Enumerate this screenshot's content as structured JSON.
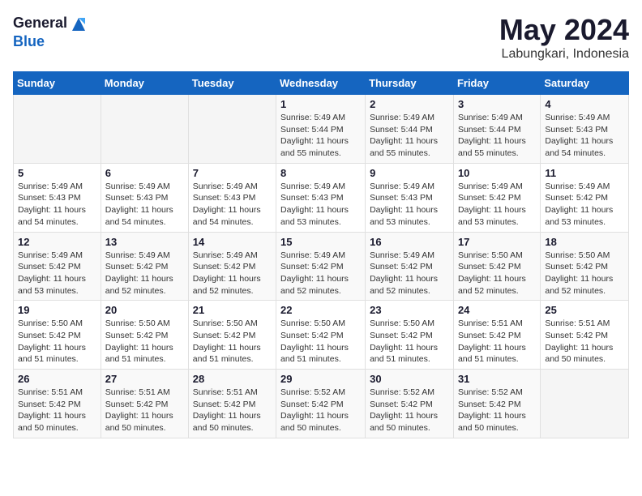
{
  "logo": {
    "general": "General",
    "blue": "Blue"
  },
  "title": {
    "month_year": "May 2024",
    "location": "Labungkari, Indonesia"
  },
  "weekdays": [
    "Sunday",
    "Monday",
    "Tuesday",
    "Wednesday",
    "Thursday",
    "Friday",
    "Saturday"
  ],
  "weeks": [
    [
      {
        "day": "",
        "sunrise": "",
        "sunset": "",
        "daylight": ""
      },
      {
        "day": "",
        "sunrise": "",
        "sunset": "",
        "daylight": ""
      },
      {
        "day": "",
        "sunrise": "",
        "sunset": "",
        "daylight": ""
      },
      {
        "day": "1",
        "sunrise": "Sunrise: 5:49 AM",
        "sunset": "Sunset: 5:44 PM",
        "daylight": "Daylight: 11 hours and 55 minutes."
      },
      {
        "day": "2",
        "sunrise": "Sunrise: 5:49 AM",
        "sunset": "Sunset: 5:44 PM",
        "daylight": "Daylight: 11 hours and 55 minutes."
      },
      {
        "day": "3",
        "sunrise": "Sunrise: 5:49 AM",
        "sunset": "Sunset: 5:44 PM",
        "daylight": "Daylight: 11 hours and 55 minutes."
      },
      {
        "day": "4",
        "sunrise": "Sunrise: 5:49 AM",
        "sunset": "Sunset: 5:43 PM",
        "daylight": "Daylight: 11 hours and 54 minutes."
      }
    ],
    [
      {
        "day": "5",
        "sunrise": "Sunrise: 5:49 AM",
        "sunset": "Sunset: 5:43 PM",
        "daylight": "Daylight: 11 hours and 54 minutes."
      },
      {
        "day": "6",
        "sunrise": "Sunrise: 5:49 AM",
        "sunset": "Sunset: 5:43 PM",
        "daylight": "Daylight: 11 hours and 54 minutes."
      },
      {
        "day": "7",
        "sunrise": "Sunrise: 5:49 AM",
        "sunset": "Sunset: 5:43 PM",
        "daylight": "Daylight: 11 hours and 54 minutes."
      },
      {
        "day": "8",
        "sunrise": "Sunrise: 5:49 AM",
        "sunset": "Sunset: 5:43 PM",
        "daylight": "Daylight: 11 hours and 53 minutes."
      },
      {
        "day": "9",
        "sunrise": "Sunrise: 5:49 AM",
        "sunset": "Sunset: 5:43 PM",
        "daylight": "Daylight: 11 hours and 53 minutes."
      },
      {
        "day": "10",
        "sunrise": "Sunrise: 5:49 AM",
        "sunset": "Sunset: 5:42 PM",
        "daylight": "Daylight: 11 hours and 53 minutes."
      },
      {
        "day": "11",
        "sunrise": "Sunrise: 5:49 AM",
        "sunset": "Sunset: 5:42 PM",
        "daylight": "Daylight: 11 hours and 53 minutes."
      }
    ],
    [
      {
        "day": "12",
        "sunrise": "Sunrise: 5:49 AM",
        "sunset": "Sunset: 5:42 PM",
        "daylight": "Daylight: 11 hours and 53 minutes."
      },
      {
        "day": "13",
        "sunrise": "Sunrise: 5:49 AM",
        "sunset": "Sunset: 5:42 PM",
        "daylight": "Daylight: 11 hours and 52 minutes."
      },
      {
        "day": "14",
        "sunrise": "Sunrise: 5:49 AM",
        "sunset": "Sunset: 5:42 PM",
        "daylight": "Daylight: 11 hours and 52 minutes."
      },
      {
        "day": "15",
        "sunrise": "Sunrise: 5:49 AM",
        "sunset": "Sunset: 5:42 PM",
        "daylight": "Daylight: 11 hours and 52 minutes."
      },
      {
        "day": "16",
        "sunrise": "Sunrise: 5:49 AM",
        "sunset": "Sunset: 5:42 PM",
        "daylight": "Daylight: 11 hours and 52 minutes."
      },
      {
        "day": "17",
        "sunrise": "Sunrise: 5:50 AM",
        "sunset": "Sunset: 5:42 PM",
        "daylight": "Daylight: 11 hours and 52 minutes."
      },
      {
        "day": "18",
        "sunrise": "Sunrise: 5:50 AM",
        "sunset": "Sunset: 5:42 PM",
        "daylight": "Daylight: 11 hours and 52 minutes."
      }
    ],
    [
      {
        "day": "19",
        "sunrise": "Sunrise: 5:50 AM",
        "sunset": "Sunset: 5:42 PM",
        "daylight": "Daylight: 11 hours and 51 minutes."
      },
      {
        "day": "20",
        "sunrise": "Sunrise: 5:50 AM",
        "sunset": "Sunset: 5:42 PM",
        "daylight": "Daylight: 11 hours and 51 minutes."
      },
      {
        "day": "21",
        "sunrise": "Sunrise: 5:50 AM",
        "sunset": "Sunset: 5:42 PM",
        "daylight": "Daylight: 11 hours and 51 minutes."
      },
      {
        "day": "22",
        "sunrise": "Sunrise: 5:50 AM",
        "sunset": "Sunset: 5:42 PM",
        "daylight": "Daylight: 11 hours and 51 minutes."
      },
      {
        "day": "23",
        "sunrise": "Sunrise: 5:50 AM",
        "sunset": "Sunset: 5:42 PM",
        "daylight": "Daylight: 11 hours and 51 minutes."
      },
      {
        "day": "24",
        "sunrise": "Sunrise: 5:51 AM",
        "sunset": "Sunset: 5:42 PM",
        "daylight": "Daylight: 11 hours and 51 minutes."
      },
      {
        "day": "25",
        "sunrise": "Sunrise: 5:51 AM",
        "sunset": "Sunset: 5:42 PM",
        "daylight": "Daylight: 11 hours and 50 minutes."
      }
    ],
    [
      {
        "day": "26",
        "sunrise": "Sunrise: 5:51 AM",
        "sunset": "Sunset: 5:42 PM",
        "daylight": "Daylight: 11 hours and 50 minutes."
      },
      {
        "day": "27",
        "sunrise": "Sunrise: 5:51 AM",
        "sunset": "Sunset: 5:42 PM",
        "daylight": "Daylight: 11 hours and 50 minutes."
      },
      {
        "day": "28",
        "sunrise": "Sunrise: 5:51 AM",
        "sunset": "Sunset: 5:42 PM",
        "daylight": "Daylight: 11 hours and 50 minutes."
      },
      {
        "day": "29",
        "sunrise": "Sunrise: 5:52 AM",
        "sunset": "Sunset: 5:42 PM",
        "daylight": "Daylight: 11 hours and 50 minutes."
      },
      {
        "day": "30",
        "sunrise": "Sunrise: 5:52 AM",
        "sunset": "Sunset: 5:42 PM",
        "daylight": "Daylight: 11 hours and 50 minutes."
      },
      {
        "day": "31",
        "sunrise": "Sunrise: 5:52 AM",
        "sunset": "Sunset: 5:42 PM",
        "daylight": "Daylight: 11 hours and 50 minutes."
      },
      {
        "day": "",
        "sunrise": "",
        "sunset": "",
        "daylight": ""
      }
    ]
  ]
}
